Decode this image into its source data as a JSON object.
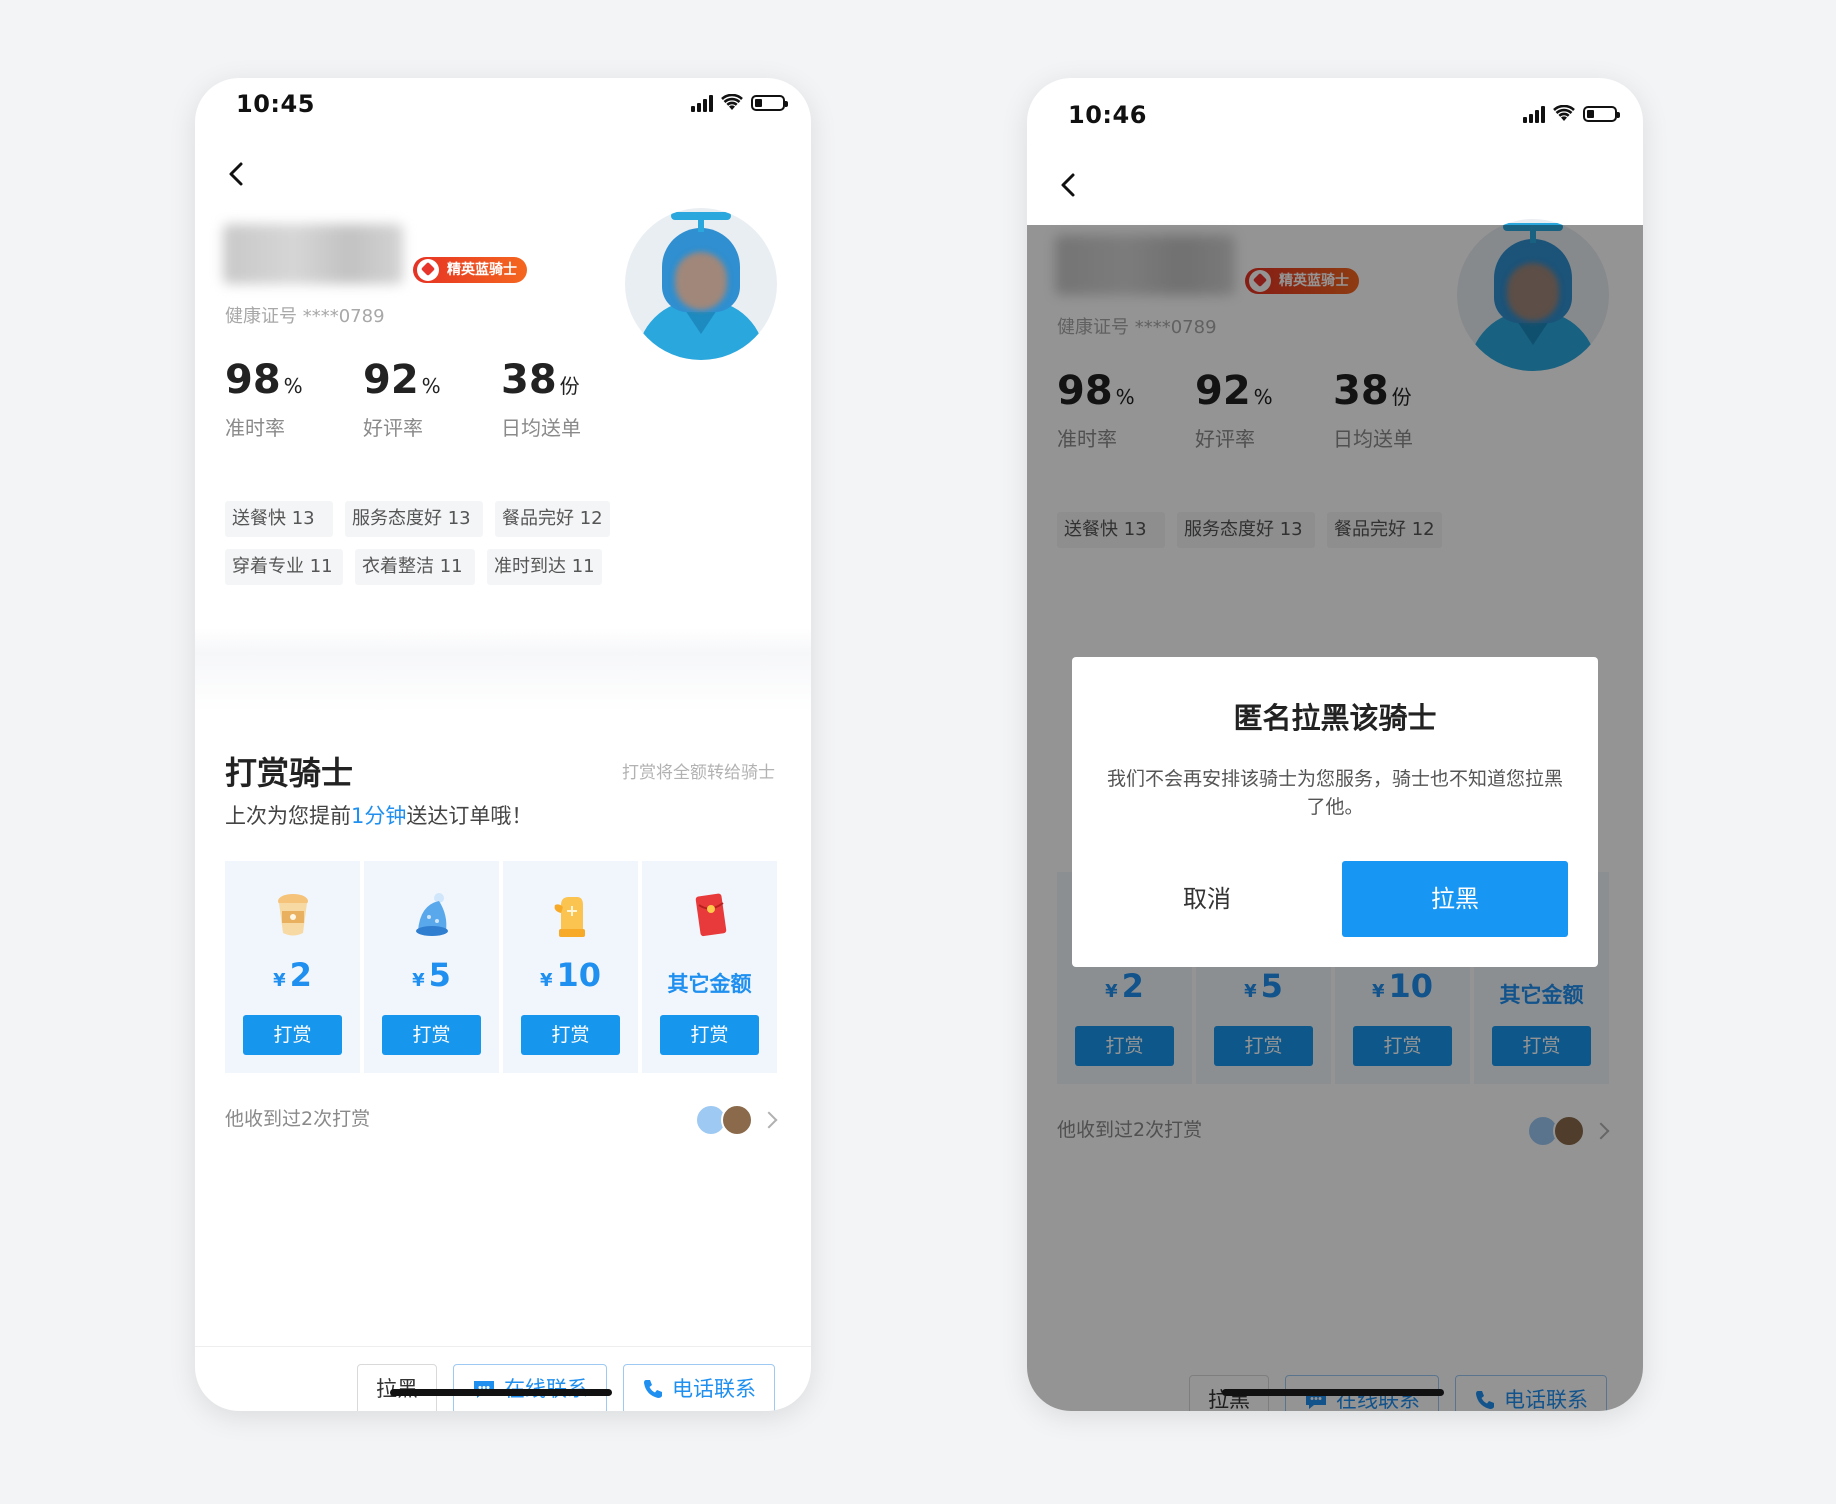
{
  "left": {
    "time": "10:45",
    "badge": "精英蓝骑士",
    "cert": "健康证号 ****0789",
    "stats": [
      {
        "num": "98",
        "unit": "%",
        "label": "准时率"
      },
      {
        "num": "92",
        "unit": "%",
        "label": "好评率"
      },
      {
        "num": "38",
        "unit": "份",
        "label": "日均送单"
      }
    ],
    "tags": [
      "送餐快 13",
      "服务态度好 13",
      "餐品完好 12",
      "穿着专业 11",
      "衣着整洁 11",
      "准时到达 11"
    ],
    "tip_title": "打赏骑士",
    "tip_note": "打赏将全额转给骑士",
    "tip_sub_before": "上次为您提前",
    "tip_sub_hl": "1分钟",
    "tip_sub_after": "送达订单哦！",
    "cards": [
      {
        "currency": "¥",
        "amount": "2",
        "button": "打赏",
        "gift": "coffee-icon"
      },
      {
        "currency": "¥",
        "amount": "5",
        "button": "打赏",
        "gift": "hat-icon"
      },
      {
        "currency": "¥",
        "amount": "10",
        "button": "打赏",
        "gift": "glove-icon"
      },
      {
        "currency": "",
        "amount": "其它金额",
        "button": "打赏",
        "gift": "red-envelope-icon"
      }
    ],
    "received": "他收到过2次打赏",
    "actions": {
      "block": "拉黑",
      "chat": "在线联系",
      "call": "电话联系"
    }
  },
  "right": {
    "time": "10:46",
    "badge": "精英蓝骑士",
    "cert": "健康证号 ****0789",
    "stats": [
      {
        "num": "98",
        "unit": "%",
        "label": "准时率"
      },
      {
        "num": "92",
        "unit": "%",
        "label": "好评率"
      },
      {
        "num": "38",
        "unit": "份",
        "label": "日均送单"
      }
    ],
    "tags": [
      "送餐快 13",
      "服务态度好 13",
      "餐品完好 12"
    ],
    "cards": [
      {
        "currency": "¥",
        "amount": "2",
        "button": "打赏"
      },
      {
        "currency": "¥",
        "amount": "5",
        "button": "打赏"
      },
      {
        "currency": "¥",
        "amount": "10",
        "button": "打赏"
      },
      {
        "currency": "",
        "amount": "其它金额",
        "button": "打赏"
      }
    ],
    "received": "他收到过2次打赏",
    "actions": {
      "block": "拉黑",
      "chat": "在线联系",
      "call": "电话联系"
    },
    "dialog": {
      "title": "匿名拉黑该骑士",
      "body": "我们不会再安排该骑士为您服务，骑士也不知道您拉黑了他。",
      "cancel": "取消",
      "confirm": "拉黑"
    }
  },
  "colors": {
    "accent": "#1f8ff0",
    "button": "#1796ee",
    "badge": "#e63224"
  }
}
